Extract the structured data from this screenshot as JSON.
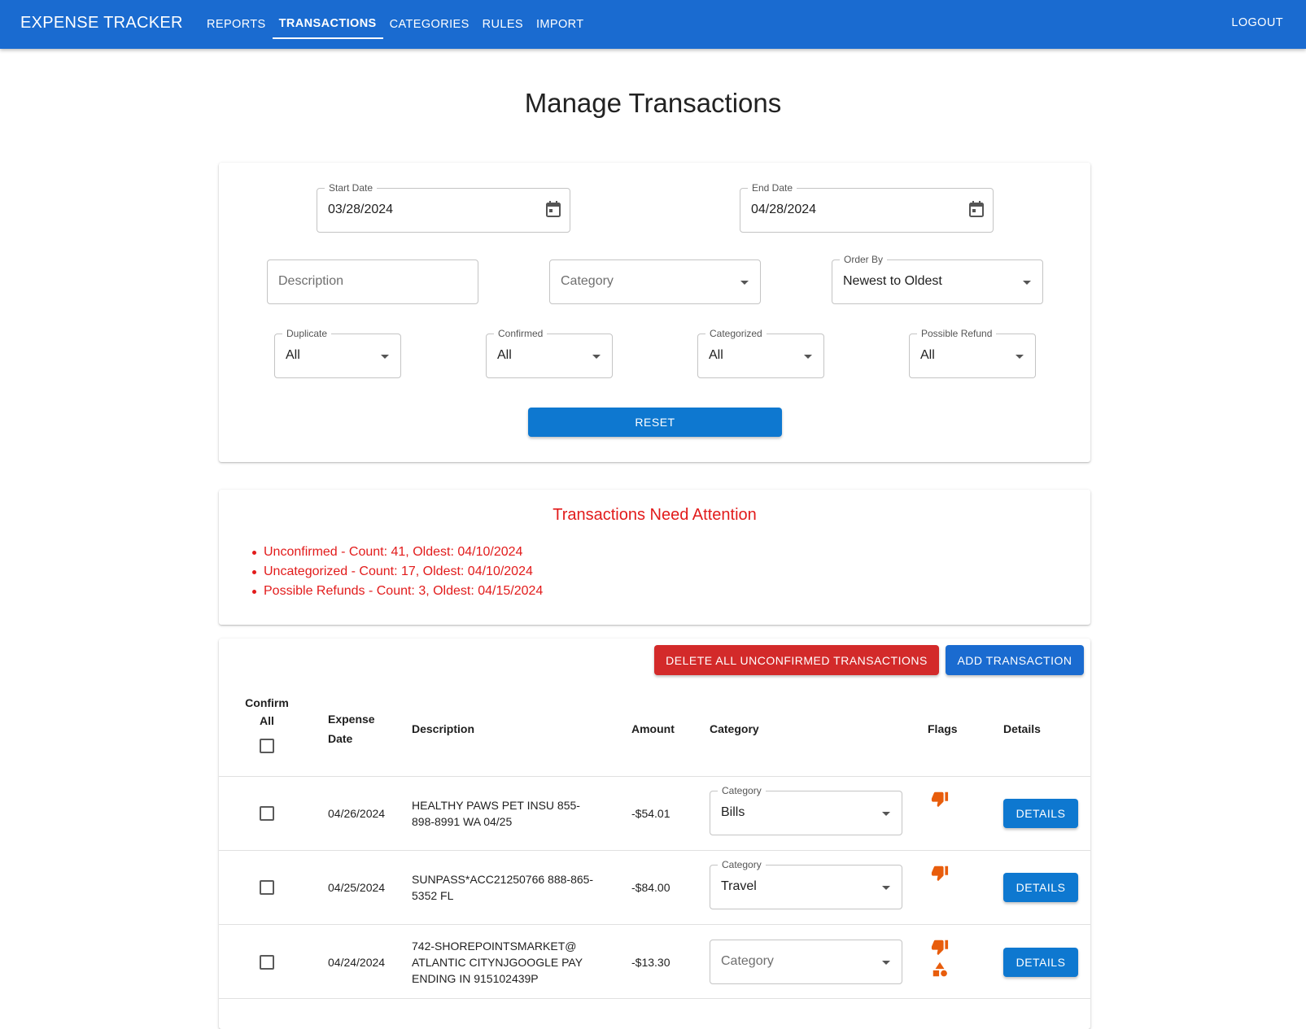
{
  "app": {
    "brand": "EXPENSE TRACKER",
    "nav": [
      "REPORTS",
      "TRANSACTIONS",
      "CATEGORIES",
      "RULES",
      "IMPORT"
    ],
    "active_nav": "TRANSACTIONS",
    "logout": "LOGOUT",
    "accent_color": "#1a6bd0"
  },
  "page_title": "Manage Transactions",
  "filters": {
    "start_date": {
      "label": "Start Date",
      "value": "03/28/2024"
    },
    "end_date": {
      "label": "End Date",
      "value": "04/28/2024"
    },
    "description": {
      "placeholder": "Description"
    },
    "category": {
      "placeholder": "Category"
    },
    "order_by": {
      "label": "Order By",
      "value": "Newest to Oldest"
    },
    "duplicate": {
      "label": "Duplicate",
      "value": "All"
    },
    "confirmed": {
      "label": "Confirmed",
      "value": "All"
    },
    "categorized": {
      "label": "Categorized",
      "value": "All"
    },
    "possible_refund": {
      "label": "Possible Refund",
      "value": "All"
    },
    "reset": "RESET"
  },
  "attention": {
    "title": "Transactions Need Attention",
    "items": [
      "Unconfirmed - Count: 41, Oldest: 04/10/2024",
      "Uncategorized - Count: 17, Oldest: 04/10/2024",
      "Possible Refunds - Count: 3, Oldest: 04/15/2024"
    ],
    "color": "#e21b1b"
  },
  "table": {
    "delete_all": "DELETE ALL UNCONFIRMED TRANSACTIONS",
    "add": "ADD TRANSACTION",
    "headers": {
      "confirm_1": "Confirm",
      "confirm_2": "All",
      "date_1": "Expense",
      "date_2": "Date",
      "description": "Description",
      "amount": "Amount",
      "category": "Category",
      "flags": "Flags",
      "details": "Details"
    },
    "category_label": "Category",
    "details_label": "DETAILS",
    "rows": [
      {
        "date": "04/26/2024",
        "description_1": "HEALTHY PAWS PET INSU 855-",
        "description_2": "898-8991 WA 04/25",
        "description_3": "",
        "amount": "-$54.01",
        "category": "Bills",
        "flags": [
          "thumbs-down-icon"
        ]
      },
      {
        "date": "04/25/2024",
        "description_1": "SUNPASS*ACC21250766 888-865-",
        "description_2": "5352 FL",
        "description_3": "",
        "amount": "-$84.00",
        "category": "Travel",
        "flags": [
          "thumbs-down-icon"
        ]
      },
      {
        "date": "04/24/2024",
        "description_1": "742-SHOREPOINTSMARKET@",
        "description_2": "ATLANTIC CITYNJGOOGLE PAY",
        "description_3": "ENDING IN 915102439P",
        "amount": "-$13.30",
        "category": "",
        "flags": [
          "thumbs-down-icon",
          "shapes-icon"
        ]
      }
    ],
    "flag_color": "#e85d0c"
  }
}
